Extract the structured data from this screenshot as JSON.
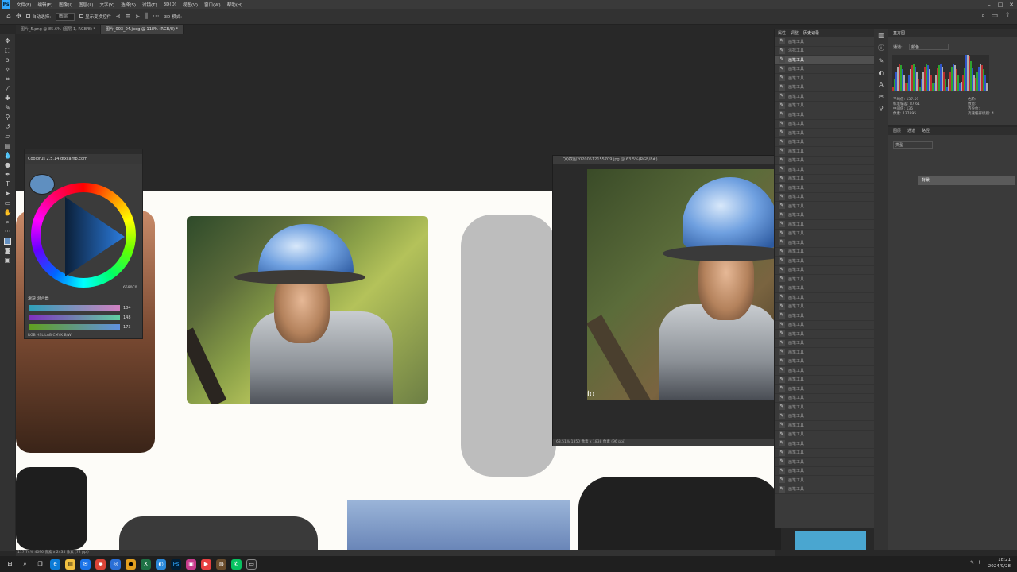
{
  "menubar": {
    "logo": "Ps",
    "items": [
      "文件(F)",
      "编辑(E)",
      "图像(I)",
      "图层(L)",
      "文字(Y)",
      "选择(S)",
      "滤镜(T)",
      "3D(D)",
      "视图(V)",
      "窗口(W)",
      "帮助(H)"
    ]
  },
  "options": {
    "auto_select_label": "自动选择:",
    "auto_select_value": "图层",
    "transform_label": "显示变换控件",
    "mode_3d": "3D 模式:"
  },
  "tabs": [
    "图片_5.png @ 85.6% (图层 1, RGB/8) *",
    "图片_003_04.jpeg @ 118% (RGB/8) *"
  ],
  "color_panel": {
    "title": "Coolorus 2.5.14 gfxcamp.com",
    "tabs": "滑块  混合器",
    "values": [
      "184",
      "148",
      "173"
    ],
    "modes": "RGB HSL LAB CMYK B/W",
    "hex": "6590C0"
  },
  "doc_window": {
    "title": "QQ截图20200512155709.jpg @ 63.5%(RGB/8#)",
    "status": "63.51%   1350 像素 x 1838 像素 (96 ppi)",
    "overlay_text": "to"
  },
  "history": {
    "tabs": [
      "属性",
      "调整",
      "历史记录"
    ],
    "items": [
      "画笔工具",
      "涂抹工具",
      "画笔工具",
      "画笔工具",
      "画笔工具",
      "画笔工具",
      "画笔工具",
      "画笔工具",
      "画笔工具",
      "画笔工具",
      "画笔工具",
      "画笔工具",
      "画笔工具",
      "画笔工具",
      "画笔工具",
      "画笔工具",
      "画笔工具",
      "画笔工具",
      "画笔工具",
      "画笔工具",
      "画笔工具",
      "画笔工具",
      "画笔工具",
      "画笔工具",
      "画笔工具",
      "画笔工具",
      "画笔工具",
      "画笔工具",
      "画笔工具",
      "画笔工具",
      "画笔工具",
      "画笔工具",
      "画笔工具",
      "画笔工具",
      "画笔工具",
      "画笔工具",
      "画笔工具",
      "画笔工具",
      "画笔工具",
      "画笔工具",
      "画笔工具",
      "画笔工具",
      "画笔工具",
      "画笔工具",
      "画笔工具",
      "画笔工具",
      "画笔工具",
      "画笔工具",
      "画笔工具",
      "画笔工具"
    ]
  },
  "histogram": {
    "title": "直方图",
    "channel_label": "通道:",
    "channel": "颜色",
    "stats": [
      "平均值: 137.59",
      "标准偏差: 87.61",
      "中间值: 136",
      "像素: 137895"
    ],
    "stats2": [
      "色阶:",
      "数量:",
      "百分位:",
      "高速缓存级别: 4"
    ]
  },
  "layers": {
    "tabs": [
      "图层",
      "通道",
      "路径"
    ],
    "search": "类型",
    "layer_name": "背景"
  },
  "statusbar": "117.74%   4096 像素 x 2435 像素 (72 ppi)",
  "clock": {
    "time": "18:21",
    "date": "2024/9/28"
  }
}
